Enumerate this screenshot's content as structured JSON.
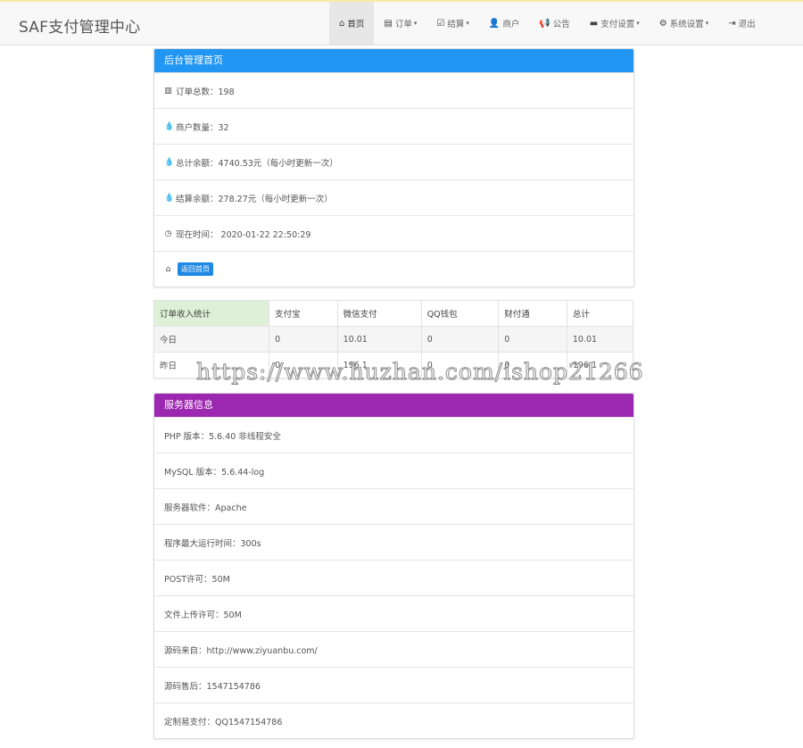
{
  "app": {
    "brand": "SAF支付管理中心"
  },
  "nav": [
    {
      "icon": "home-icon",
      "glyph": "⌂",
      "label": "首页",
      "dropdown": false,
      "active": true
    },
    {
      "icon": "list-icon",
      "glyph": "▤",
      "label": "订单",
      "dropdown": true,
      "active": false
    },
    {
      "icon": "check-square-icon",
      "glyph": "☑",
      "label": "结算",
      "dropdown": true,
      "active": false
    },
    {
      "icon": "user-icon",
      "glyph": "👤",
      "label": "商户",
      "dropdown": false,
      "active": false
    },
    {
      "icon": "bullhorn-icon",
      "glyph": "📢",
      "label": "公告",
      "dropdown": false,
      "active": false
    },
    {
      "icon": "credit-card-icon",
      "glyph": "▬",
      "label": "支付设置",
      "dropdown": true,
      "active": false
    },
    {
      "icon": "gear-icon",
      "glyph": "⚙",
      "label": "系统设置",
      "dropdown": true,
      "active": false
    },
    {
      "icon": "logout-icon",
      "glyph": "⇥",
      "label": "退出",
      "dropdown": false,
      "active": false
    }
  ],
  "admin_panel": {
    "title": "后台管理首页",
    "color": "#2196f3",
    "rows": [
      {
        "icon": "bar-chart-icon",
        "glyph": "▥",
        "text": "订单总数：198"
      },
      {
        "icon": "drop-icon",
        "glyph": "💧",
        "text": "商户数量：32"
      },
      {
        "icon": "drop-icon",
        "glyph": "💧",
        "text": "总计余额：4740.53元（每小时更新一次）"
      },
      {
        "icon": "drop-icon",
        "glyph": "💧",
        "text": "结算余额：278.27元（每小时更新一次）"
      },
      {
        "icon": "clock-icon",
        "glyph": "◷",
        "text": "现在时间： 2020-01-22 22:50:29"
      }
    ],
    "home_button": "返回首页"
  },
  "stats_table": {
    "headers": [
      "订单收入统计",
      "支付宝",
      "微信支付",
      "QQ钱包",
      "财付通",
      "总计"
    ],
    "rows": [
      [
        "今日",
        "0",
        "10.01",
        "0",
        "0",
        "10.01"
      ],
      [
        "昨日",
        "0",
        "196.1",
        "0",
        "0",
        "196.1"
      ]
    ]
  },
  "server_panel": {
    "title": "服务器信息",
    "color": "#9c27b0",
    "rows": [
      "PHP 版本：5.6.40 非线程安全",
      "MySQL 版本：5.6.44-log",
      "服务器软件：Apache",
      "程序最大运行时间：300s",
      "POST许可：50M",
      "文件上传许可：50M",
      "源码来自：http://www.ziyuanbu.com/",
      "源码售后：1547154786",
      "定制易支付：QQ1547154786"
    ]
  },
  "watermark": "https://www.huzhan.com/ishop21266"
}
